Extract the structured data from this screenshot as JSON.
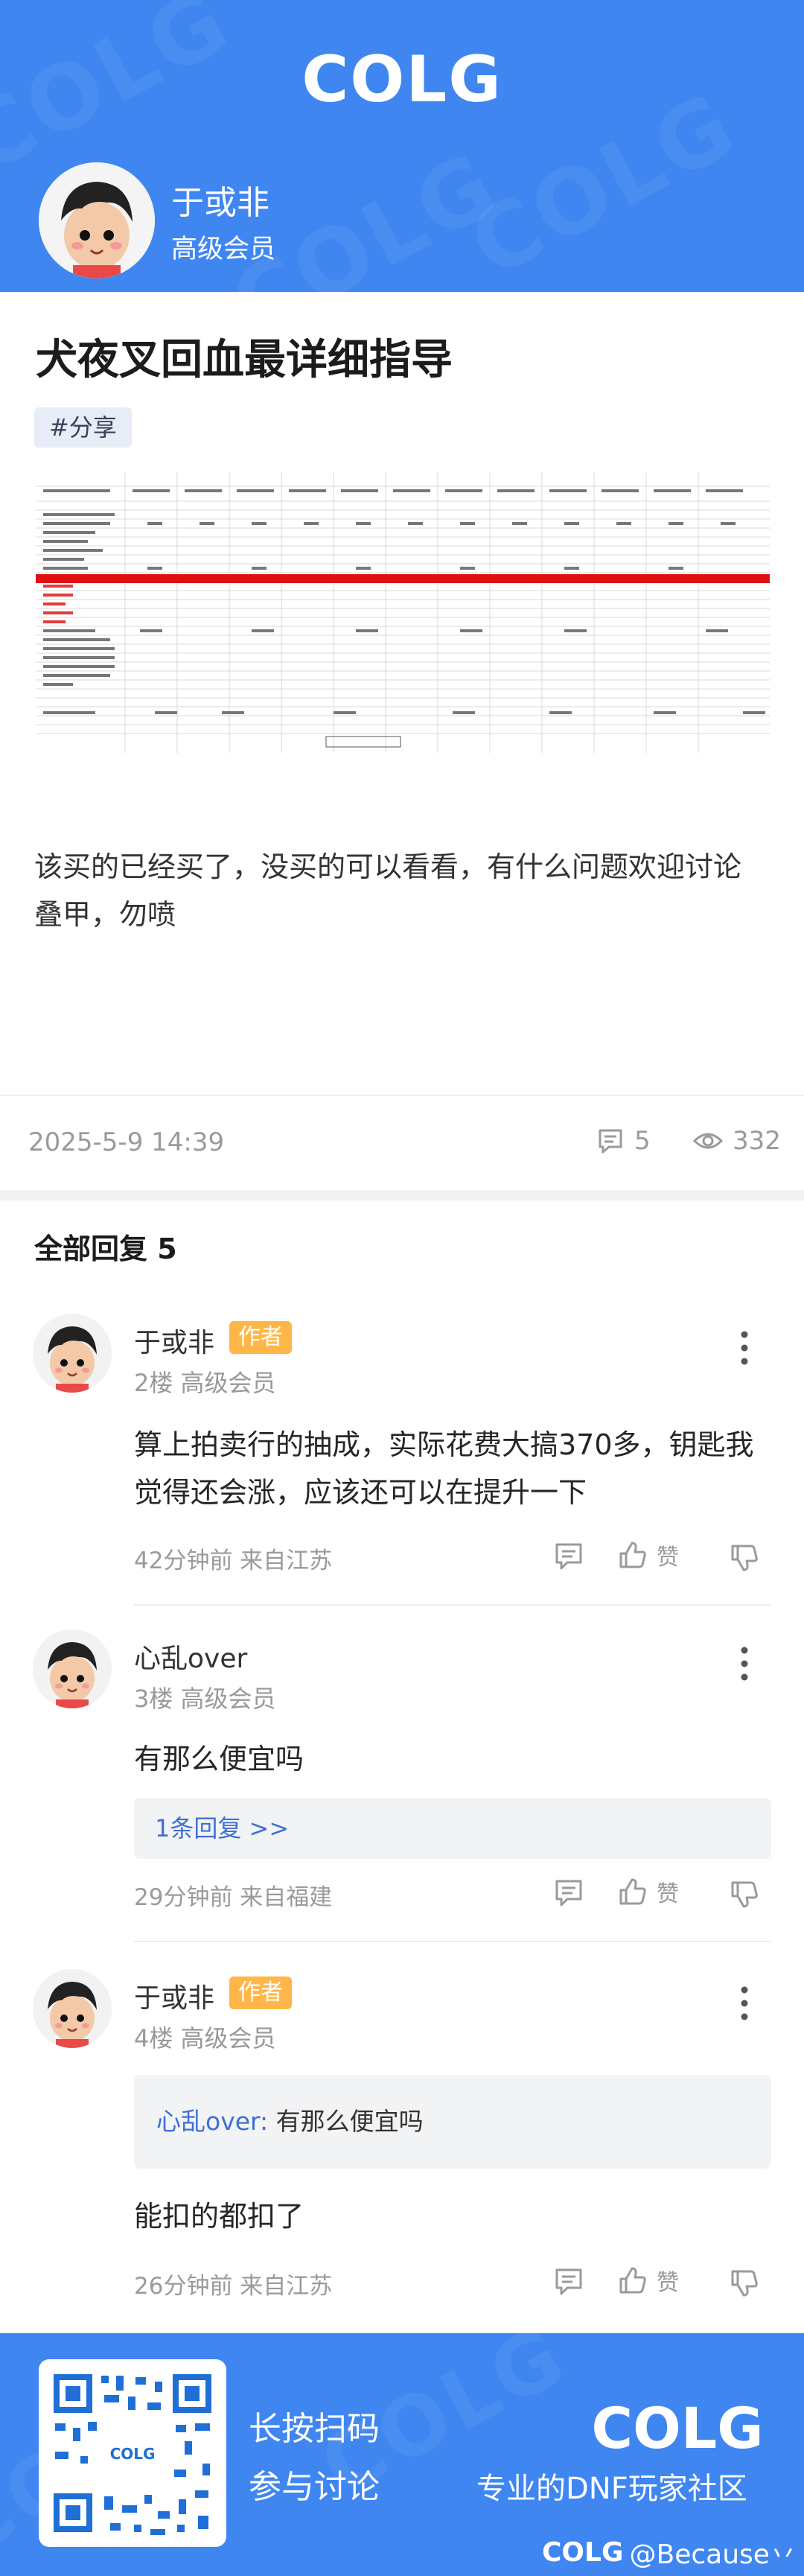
{
  "header": {
    "logo_text": "COLG",
    "author_name": "于或非",
    "author_level": "高级会员"
  },
  "post": {
    "title": "犬夜叉回血最详细指导",
    "tag": "#分享",
    "body_lines": [
      "该买的已经买了，没买的可以看看，有什么问题欢迎讨论",
      "叠甲，勿喷"
    ],
    "date": "2025-5-9 14:39",
    "comment_count": "5",
    "view_count": "332"
  },
  "replies": {
    "heading": "全部回复",
    "count": "5",
    "like_label": "赞",
    "items": [
      {
        "name": "于或非",
        "badge": "作者",
        "floor": "2楼",
        "level": "高级会员",
        "text": "算上拍卖行的抽成，实际花费大搞370多，钥匙我觉得还会涨，应该还可以在提升一下",
        "time": "42分钟前 来自江苏"
      },
      {
        "name": "心乱over",
        "floor": "3楼",
        "level": "高级会员",
        "text": "有那么便宜吗",
        "sub_replies": "1条回复 >>",
        "time": "29分钟前 来自福建"
      },
      {
        "name": "于或非",
        "badge": "作者",
        "floor": "4楼",
        "level": "高级会员",
        "quote_author": "心乱over:",
        "quote_text": "有那么便宜吗",
        "text": "能扣的都扣了",
        "time": "26分钟前 来自江苏"
      }
    ]
  },
  "footer": {
    "cta_line1": "长按扫码",
    "cta_line2": "参与讨论",
    "logo_text": "COLG",
    "slogan": "专业的DNF玩家社区",
    "handle_logo": "COLG",
    "handle": "@Because丷"
  },
  "colors": {
    "brand_blue": "#3f86f1",
    "author_badge": "#ffb648",
    "link_blue": "#3f6fd6"
  }
}
